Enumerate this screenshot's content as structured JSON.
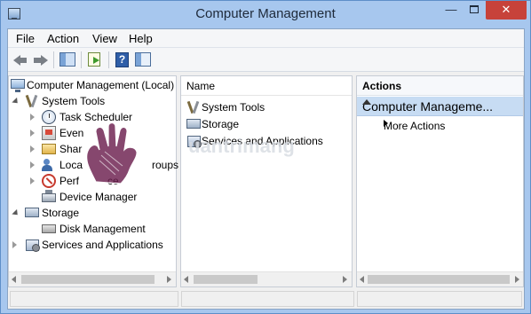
{
  "window": {
    "title": "Computer Management",
    "minimize_glyph": "—",
    "close_glyph": "✕"
  },
  "menu": {
    "items": [
      {
        "label": "File"
      },
      {
        "label": "Action"
      },
      {
        "label": "View"
      },
      {
        "label": "Help"
      }
    ]
  },
  "toolbar": {
    "buttons": [
      {
        "icon": "back-arrow-icon"
      },
      {
        "icon": "forward-arrow-icon"
      },
      {
        "icon": "show-hide-console-tree-icon"
      },
      {
        "icon": "export-list-icon"
      },
      {
        "icon": "help-icon",
        "glyph": "?"
      },
      {
        "icon": "show-hide-action-pane-icon"
      }
    ]
  },
  "tree": {
    "root": "Computer Management (Local)",
    "system_tools": "System Tools",
    "task_scheduler": "Task Scheduler",
    "event_viewer": "Even",
    "shared_folders": "Shar",
    "local_users": "Loca",
    "local_users_tail": "roups",
    "performance": "Perf",
    "performance_tail": "ce",
    "device_manager": "Device Manager",
    "storage": "Storage",
    "disk_management": "Disk Management",
    "services": "Services and Applications"
  },
  "middle": {
    "header": "Name",
    "items": [
      {
        "label": "System Tools",
        "icon": "tools-icon"
      },
      {
        "label": "Storage",
        "icon": "storage-icon"
      },
      {
        "label": "Services and Applications",
        "icon": "services-icon"
      }
    ]
  },
  "actions": {
    "header": "Actions",
    "section": "Computer Manageme...",
    "more": "More Actions"
  },
  "watermark": "uantrimang",
  "colors": {
    "title_bg": "#a7c7ee",
    "close_button": "#c7423a",
    "action_section_bg": "#c7dcf3"
  }
}
